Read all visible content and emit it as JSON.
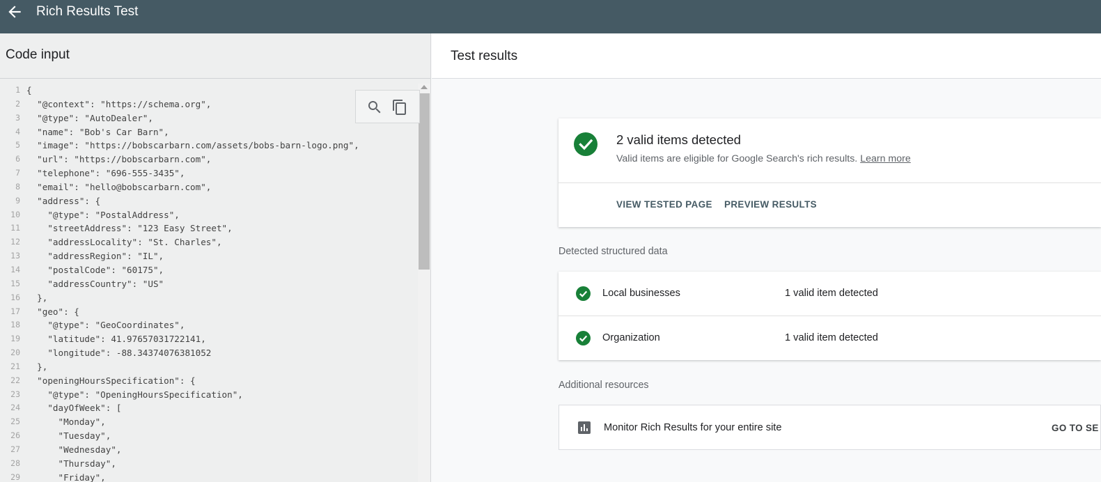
{
  "app": {
    "title": "Rich Results Test"
  },
  "left_panel": {
    "title": "Code input",
    "code_lines": [
      "{",
      "  \"@context\": \"https://schema.org\",",
      "  \"@type\": \"AutoDealer\",",
      "  \"name\": \"Bob's Car Barn\",",
      "  \"image\": \"https://bobscarbarn.com/assets/bobs-barn-logo.png\",",
      "  \"url\": \"https://bobscarbarn.com\",",
      "  \"telephone\": \"696-555-3435\",",
      "  \"email\": \"hello@bobscarbarn.com\",",
      "  \"address\": {",
      "    \"@type\": \"PostalAddress\",",
      "    \"streetAddress\": \"123 Easy Street\",",
      "    \"addressLocality\": \"St. Charles\",",
      "    \"addressRegion\": \"IL\",",
      "    \"postalCode\": \"60175\",",
      "    \"addressCountry\": \"US\"",
      "  },",
      "  \"geo\": {",
      "    \"@type\": \"GeoCoordinates\",",
      "    \"latitude\": 41.97657031722141,",
      "    \"longitude\": -88.34374076381052",
      "  },",
      "  \"openingHoursSpecification\": {",
      "    \"@type\": \"OpeningHoursSpecification\",",
      "    \"dayOfWeek\": [",
      "      \"Monday\",",
      "      \"Tuesday\",",
      "      \"Wednesday\",",
      "      \"Thursday\",",
      "      \"Friday\","
    ],
    "tools": [
      "search-icon",
      "copy-icon"
    ]
  },
  "right_panel": {
    "title": "Test results",
    "summary": {
      "title": "2 valid items detected",
      "subtitle": "Valid items are eligible for Google Search's rich results.",
      "learn_more": "Learn more",
      "actions": [
        "VIEW TESTED PAGE",
        "PREVIEW RESULTS"
      ]
    },
    "detected_label": "Detected structured data",
    "detected_items": [
      {
        "name": "Local businesses",
        "status": "1 valid item detected"
      },
      {
        "name": "Organization",
        "status": "1 valid item detected"
      }
    ],
    "resources_label": "Additional resources",
    "resources": [
      {
        "label": "Monitor Rich Results for your entire site",
        "action": "GO TO SE"
      }
    ]
  },
  "colors": {
    "appbar": "#455a64",
    "valid_green": "#188038",
    "text_primary": "#202124",
    "text_secondary": "#5f6368"
  }
}
